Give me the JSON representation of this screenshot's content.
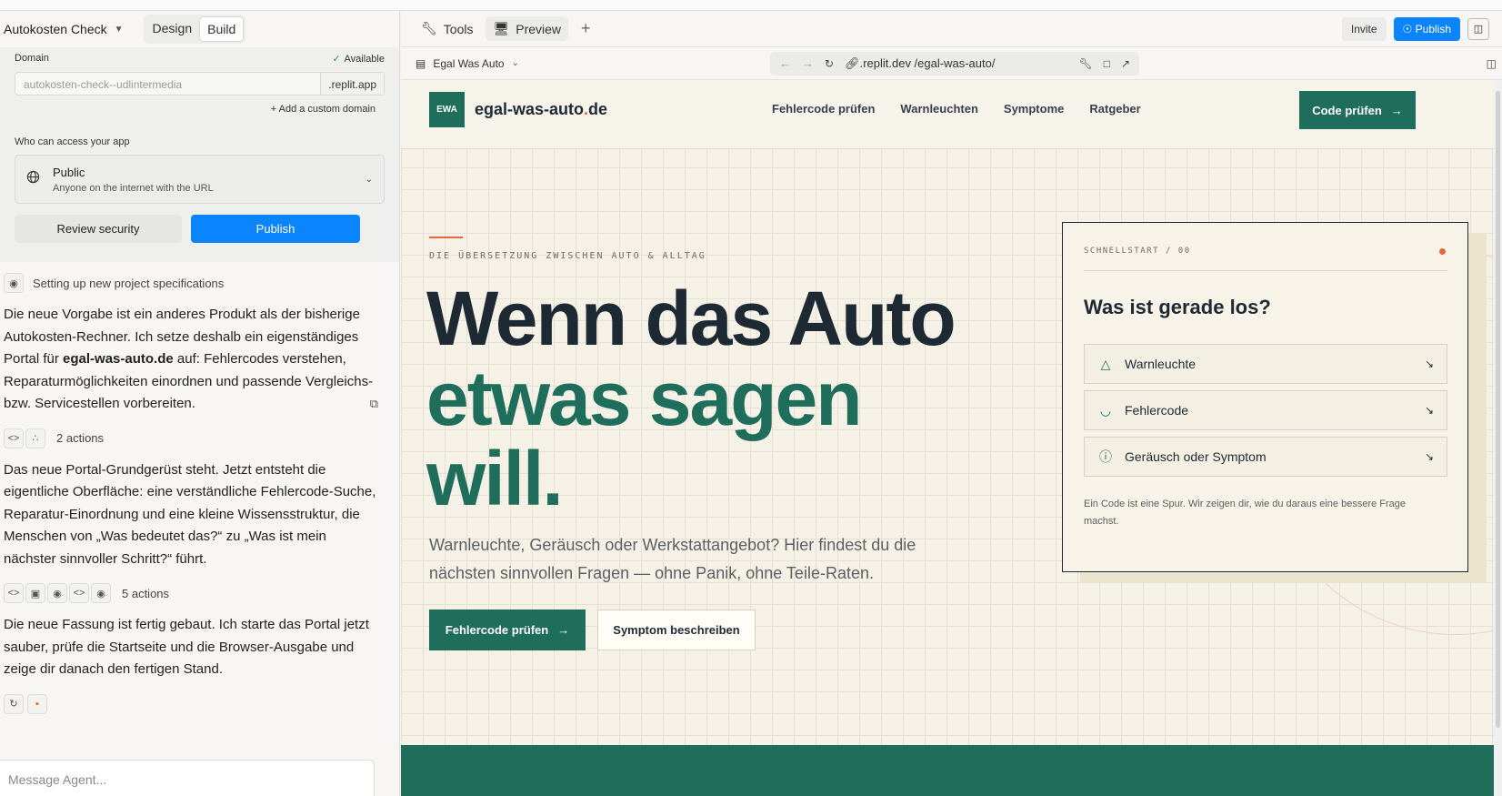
{
  "project": {
    "name": "Autokosten Check",
    "modes": [
      "Design",
      "Build"
    ]
  },
  "publish": {
    "domain_label": "Domain",
    "available": "Available",
    "domain_value": "autokosten-check--udlintermedia",
    "domain_suffix": ".replit.app",
    "custom_domain": "Add a custom domain",
    "access_label": "Who can access your app",
    "access_title": "Public",
    "access_sub": "Anyone on the internet with the URL",
    "review": "Review security",
    "publish": "Publish"
  },
  "chat": {
    "status": "Setting up new project specifications",
    "msg1_a": "Die neue Vorgabe ist ein anderes Produkt als der bisherige Autokosten-Rechner. Ich setze deshalb ein eigenständiges Portal für ",
    "msg1_b": "egal-was-auto.de",
    "msg1_c": " auf: Fehlercodes verstehen, Reparaturmöglichkeiten einordnen und passende Vergleichs- bzw. Servicestellen vorbereiten.",
    "actions1": "2 actions",
    "msg2": "Das neue Portal-Grundgerüst steht. Jetzt entsteht die eigentliche Oberfläche: eine verständliche Fehlercode-Suche, Reparatur-Einordnung und eine kleine Wissensstruktur, die Menschen von „Was bedeutet das?“ zu „Was ist mein nächster sinnvoller Schritt?“ führt.",
    "actions2": "5 actions",
    "msg3": "Die neue Fassung ist fertig gebaut. Ich starte das Portal jetzt sauber, prüfe die Startseite und die Browser-Ausgabe und zeige dir danach den fertigen Stand.",
    "placeholder": "Message Agent..."
  },
  "topbar": {
    "tools": "Tools",
    "preview": "Preview",
    "invite": "Invite",
    "publish": "Publish"
  },
  "browser": {
    "title": "Egal Was Auto",
    "url": ".replit.dev /egal-was-auto/"
  },
  "site": {
    "logo": "EWA",
    "brand": "egal-was-auto",
    "brand_dot": ".",
    "brand_tld": "de",
    "nav": [
      "Fehlercode prüfen",
      "Warnleuchten",
      "Symptome",
      "Ratgeber"
    ],
    "nav_cta": "Code prüfen",
    "eyebrow": "DIE ÜBERSETZUNG ZWISCHEN AUTO & ALLTAG",
    "h1_line1": "Wenn das Auto",
    "h1_line2": "etwas sagen",
    "h1_line3": "will.",
    "lead": "Warnleuchte, Geräusch oder Werkstattangebot? Hier findest du die nächsten sinnvollen Fragen — ohne Panik, ohne Teile-Raten.",
    "btn_primary": "Fehlercode prüfen",
    "btn_secondary": "Symptom beschreiben",
    "card": {
      "eyebrow": "SCHNELLSTART / 00",
      "title": "Was ist gerade los?",
      "options": [
        "Warnleuchte",
        "Fehlercode",
        "Geräusch oder Symptom"
      ],
      "foot": "Ein Code ist eine Spur. Wir zeigen dir, wie du daraus eine bessere Frage machst."
    }
  },
  "colors": {
    "accent_green": "#1f6e5c",
    "accent_orange": "#e06a3b",
    "publish_blue": "#0a84ff"
  }
}
